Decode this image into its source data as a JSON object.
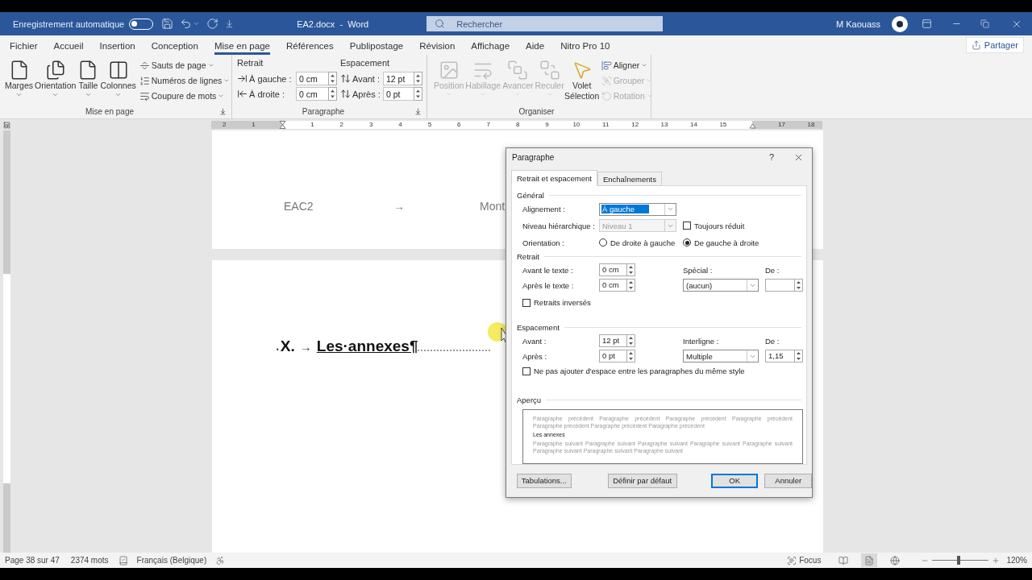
{
  "title_bar": {
    "autosave_label": "Enregistrement automatique",
    "autosave_on": false,
    "document_title": "EA2.docx  -  Word",
    "search_placeholder": "Rechercher",
    "user_name": "M Kaouass"
  },
  "ribbon_tabs": [
    {
      "label": "Fichier",
      "selected": false
    },
    {
      "label": "Accueil",
      "selected": false
    },
    {
      "label": "Insertion",
      "selected": false
    },
    {
      "label": "Conception",
      "selected": false
    },
    {
      "label": "Mise en page",
      "selected": true
    },
    {
      "label": "Références",
      "selected": false
    },
    {
      "label": "Publipostage",
      "selected": false
    },
    {
      "label": "Révision",
      "selected": false
    },
    {
      "label": "Affichage",
      "selected": false
    },
    {
      "label": "Aide",
      "selected": false
    },
    {
      "label": "Nitro Pro 10",
      "selected": false
    }
  ],
  "share_button": "Partager",
  "page_setup_group": {
    "title": "Mise en page",
    "large_buttons": [
      "Marges",
      "Orientation",
      "Taille",
      "Colonnes"
    ],
    "small_buttons": [
      "Sauts de page",
      "Numéros de lignes",
      "Coupure de mots"
    ]
  },
  "paragraph_group": {
    "title": "Paragraphe",
    "indent_heading": "Retrait",
    "spacing_heading": "Espacement",
    "indent_fields": [
      {
        "label": "À gauche :",
        "value": "0 cm"
      },
      {
        "label": "À droite :",
        "value": "0 cm"
      }
    ],
    "spacing_fields": [
      {
        "label": "Avant :",
        "value": "12 pt"
      },
      {
        "label": "Après :",
        "value": "0 pt"
      }
    ]
  },
  "arrange_group": {
    "title": "Organiser",
    "large_buttons": [
      {
        "label": "Position",
        "disabled": true
      },
      {
        "label": "Habillage",
        "disabled": true
      },
      {
        "label": "Avancer",
        "disabled": true
      },
      {
        "label": "Reculer",
        "disabled": true
      },
      {
        "label": "Volet Sélection",
        "disabled": false
      }
    ],
    "small_buttons": [
      {
        "label": "Aligner",
        "disabled": false
      },
      {
        "label": "Grouper",
        "disabled": true
      },
      {
        "label": "Rotation",
        "disabled": true
      }
    ]
  },
  "ruler": [
    {
      "kind": "number",
      "label": "2"
    },
    {
      "kind": "number",
      "label": "1"
    },
    {
      "kind": "left_indent"
    },
    {
      "kind": "number",
      "label": "1"
    },
    {
      "kind": "number",
      "label": "2"
    },
    {
      "kind": "number",
      "label": "3"
    },
    {
      "kind": "number",
      "label": "4"
    },
    {
      "kind": "number",
      "label": "5"
    },
    {
      "kind": "number",
      "label": "6"
    },
    {
      "kind": "number",
      "label": "7"
    },
    {
      "kind": "number",
      "label": "8"
    },
    {
      "kind": "number",
      "label": "9"
    },
    {
      "kind": "number",
      "label": "10"
    },
    {
      "kind": "number",
      "label": "11"
    },
    {
      "kind": "number",
      "label": "12"
    },
    {
      "kind": "number",
      "label": "13"
    },
    {
      "kind": "number",
      "label": "14"
    },
    {
      "kind": "number",
      "label": "15"
    },
    {
      "kind": "right_indent"
    },
    {
      "kind": "number",
      "label": "17"
    },
    {
      "kind": "number",
      "label": "18"
    }
  ],
  "document": {
    "previous_page_line": [
      "EAC2",
      "→",
      "Mont"
    ],
    "heading": {
      "marker": "▪",
      "number": "X.",
      "tab_mark": "→",
      "title": "Les·annexes¶"
    }
  },
  "dialog": {
    "title": "Paragraphe",
    "help": "?",
    "tabs": [
      {
        "label": "Retrait et espacement",
        "selected": true
      },
      {
        "label": "Enchaînements",
        "selected": false
      }
    ],
    "general": {
      "heading": "Général",
      "alignment": {
        "label": "Alignement :",
        "value": "À gauche",
        "highlighted": true
      },
      "outline_level": {
        "label": "Niveau hiérarchique :",
        "value": "Niveau 1",
        "disabled": true
      },
      "collapsed": {
        "label": "Toujours réduit",
        "checked": false
      },
      "orientation": {
        "label": "Orientation :",
        "options": [
          {
            "label": "De droite à gauche",
            "selected": false
          },
          {
            "label": "De gauche à droite",
            "selected": true
          }
        ]
      }
    },
    "indent": {
      "heading": "Retrait",
      "before": {
        "label": "Avant le texte :",
        "value": "0 cm"
      },
      "after": {
        "label": "Après le texte :",
        "value": "0 cm"
      },
      "special": {
        "label": "Spécial :",
        "value": "(aucun)"
      },
      "by": {
        "label": "De :"
      },
      "mirror": {
        "label": "Retraits inversés",
        "checked": false
      }
    },
    "spacing": {
      "heading": "Espacement",
      "before": {
        "label": "Avant :",
        "value": "12 pt"
      },
      "after": {
        "label": "Après :",
        "value": "0 pt"
      },
      "line_spacing": {
        "label": "Interligne :",
        "value": "Multiple"
      },
      "at": {
        "label": "De :",
        "value": "1,15"
      },
      "no_space": {
        "label": "Ne pas ajouter d'espace entre les paragraphes du même style",
        "checked": false
      }
    },
    "preview": {
      "heading": "Aperçu",
      "previous": "Paragraphe précédent Paragraphe précédent Paragraphe précédent Paragraphe précédent Paragraphe précédent Paragraphe précédent Paragraphe précédent",
      "current": "Les annexes",
      "next": "Paragraphe suivant Paragraphe suivant Paragraphe suivant Paragraphe suivant Paragraphe suivant Paragraphe suivant Paragraphe suivant Paragraphe suivant"
    },
    "buttons": [
      {
        "label": "Tabulations...",
        "default": false
      },
      {
        "label": "Définir par défaut",
        "default": false
      },
      {
        "label": "OK",
        "default": true
      },
      {
        "label": "Annuler",
        "default": false
      }
    ]
  },
  "status_bar": {
    "page": "Page 38 sur 47",
    "words": "2374 mots",
    "language": "Français (Belgique)",
    "focus": "Focus",
    "views": [
      {
        "selected": false
      },
      {
        "selected": true
      },
      {
        "selected": false
      }
    ],
    "zoom_slider": {
      "level": 0.47
    },
    "zoom": "120%"
  }
}
